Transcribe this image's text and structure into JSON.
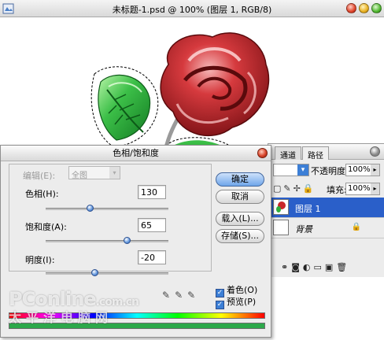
{
  "document": {
    "title": "未标题-1.psd @ 100% (图层 1, RGB/8)"
  },
  "colors": {
    "rose": "#c8262a",
    "leaf": "#2fae3c",
    "selection": "#2a5fc9"
  },
  "layers_panel": {
    "tabs": [
      "通道",
      "路径"
    ],
    "opacity_label": "不透明度:",
    "opacity_value": "100%",
    "fill_label": "填充:",
    "fill_value": "100%",
    "layers": [
      {
        "name": "图层 1",
        "selected": true
      },
      {
        "name": "背景",
        "selected": false
      }
    ]
  },
  "dialog": {
    "title": "色相/饱和度",
    "edit_label": "编辑(E):",
    "edit_value": "全图",
    "params": [
      {
        "label": "色相(H):",
        "value": "130"
      },
      {
        "label": "饱和度(A):",
        "value": "65"
      },
      {
        "label": "明度(I):",
        "value": "-20"
      }
    ],
    "slider_levels": [
      0.36,
      0.66,
      0.4
    ],
    "buttons": {
      "ok": "确定",
      "cancel": "取消",
      "load": "载入(L)...",
      "save": "存储(S)..."
    },
    "colorize_label": "着色(O)",
    "colorize_checked": true,
    "preview_label": "预览(P)",
    "preview_checked": true
  },
  "watermark": {
    "brand": "PConline",
    "domain": ".com.cn",
    "subtitle": "太平洋电脑网"
  }
}
